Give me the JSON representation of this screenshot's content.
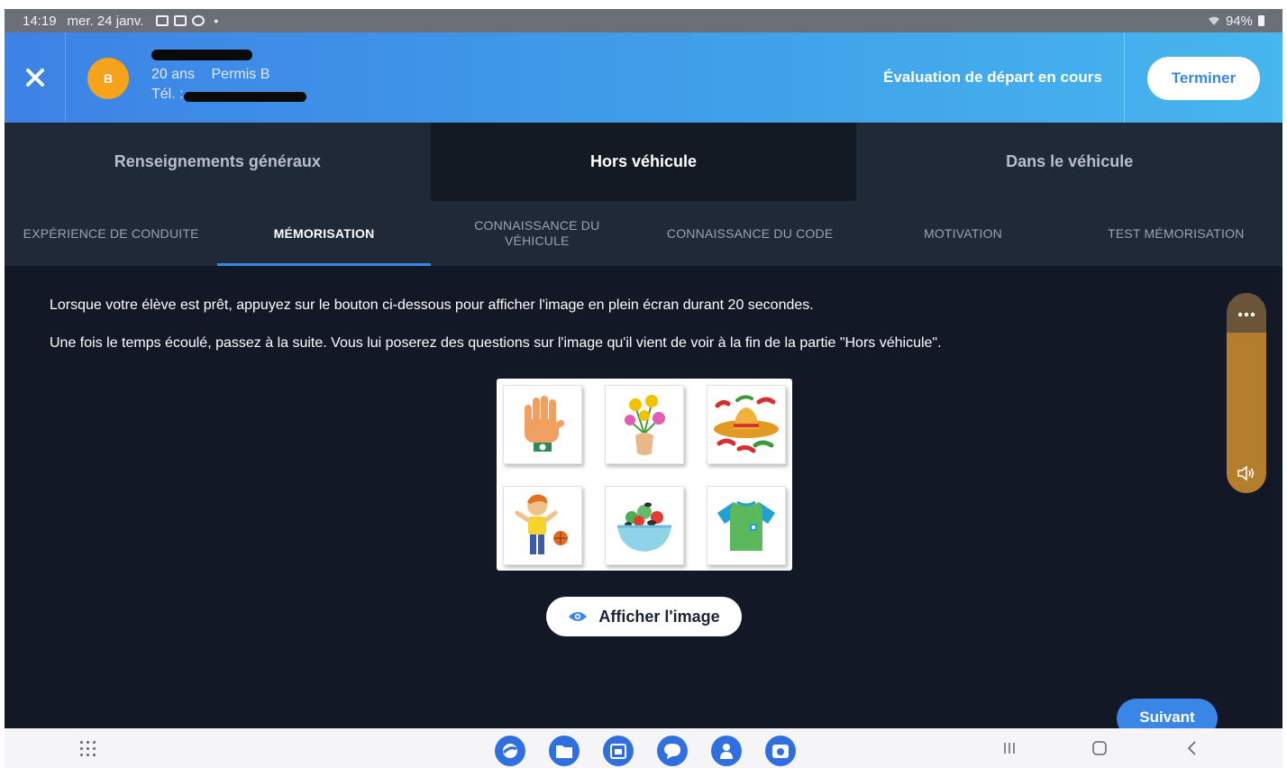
{
  "status_bar": {
    "time": "14:19",
    "date": "mer. 24 janv.",
    "dot": "•",
    "battery": "94%"
  },
  "header": {
    "avatar_initial": "B",
    "student_age": "20 ans",
    "student_license": "Permis B",
    "student_phone_prefix": "Tél. :",
    "status": "Évaluation de départ en cours",
    "finish_label": "Terminer"
  },
  "main_tabs": [
    {
      "label": "Renseignements généraux",
      "active": false
    },
    {
      "label": "Hors véhicule",
      "active": true
    },
    {
      "label": "Dans le véhicule",
      "active": false
    }
  ],
  "sub_tabs": [
    {
      "label": "EXPÉRIENCE DE CONDUITE",
      "active": false
    },
    {
      "label": "MÉMORISATION",
      "active": true
    },
    {
      "label": "CONNAISSANCE DU VÉHICULE",
      "active": false
    },
    {
      "label": "CONNAISSANCE DU CODE",
      "active": false
    },
    {
      "label": "MOTIVATION",
      "active": false
    },
    {
      "label": "TEST MÉMORISATION",
      "active": false
    }
  ],
  "content": {
    "instruction_1": "Lorsque votre élève est prêt, appuyez sur le bouton ci-dessous pour afficher l'image en plein écran durant 20 secondes.",
    "instruction_2": "Une fois le temps écoulé, passez à la suite. Vous lui poserez des questions sur l'image qu'il vient de voir à la fin de la partie \"Hors véhicule\".",
    "memory_images": [
      "hand-icon",
      "flower-vase-icon",
      "sombrero-icon",
      "boy-with-ball-icon",
      "salad-bowl-icon",
      "tshirt-icon"
    ],
    "show_image_label": "Afficher l'image",
    "next_label": "Suivant"
  },
  "volume_panel": {
    "level": 0.8
  },
  "colors": {
    "accent": "#3a86e6",
    "avatar": "#f6a21a",
    "content_bg": "#121826",
    "tabs_bg": "#1f2937",
    "volume_fill": "#b57e2d"
  }
}
